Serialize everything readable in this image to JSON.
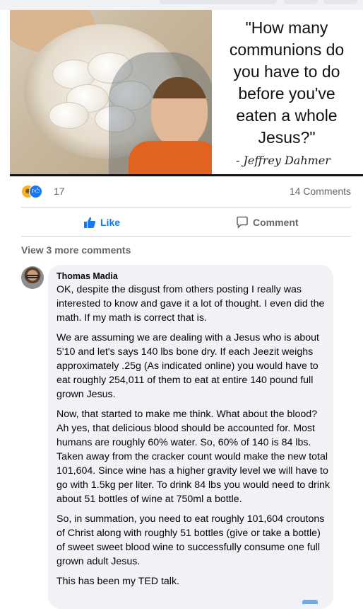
{
  "post": {
    "quote_text": "\"How many communions do you have to do before you've eaten a whole Jesus?\"",
    "quote_author": "- Jeffrey Dahmer"
  },
  "stats": {
    "reaction_count": "17",
    "comment_count": "14 Comments",
    "reaction_icons": [
      "haha-icon",
      "like-icon"
    ]
  },
  "actions": {
    "like_label": "Like",
    "comment_label": "Comment"
  },
  "comments": {
    "view_more": "View 3 more comments",
    "author": "Thomas Madia",
    "paragraphs": [
      "OK, despite the disgust from others posting I really was interested to know and gave it a lot of thought. I even did the math. If my math is correct that is.",
      "We are assuming we are dealing with a Jesus who is about 5'10 and let's says 140 lbs bone dry. If each Jeezit weighs approximately .25g (As indicated online) you would have to eat roughly 254,011 of them to eat at entire 140 pound full grown Jesus.",
      "Now, that started to make me think. What about the blood? Ah yes, that delicious blood should be accounted for. Most humans are roughly 60% water. So, 60% of 140 is 84 lbs. Taken away from the cracker count would make the new total 101,604. Since wine has a higher gravity level we will have to go with 1.5kg per liter. To drink 84 lbs you would need to drink about 51 bottles of wine at 750ml a bottle.",
      "So, in summation, you need to eat roughly 101,604 croutons of Christ along with roughly 51 bottles (give or take a bottle) of sweet sweet blood wine to successfully consume one full grown adult Jesus.",
      "This has been my TED talk."
    ]
  },
  "colors": {
    "accent": "#1877f2",
    "muted": "#65676b",
    "bubble": "#f0f2f5"
  }
}
